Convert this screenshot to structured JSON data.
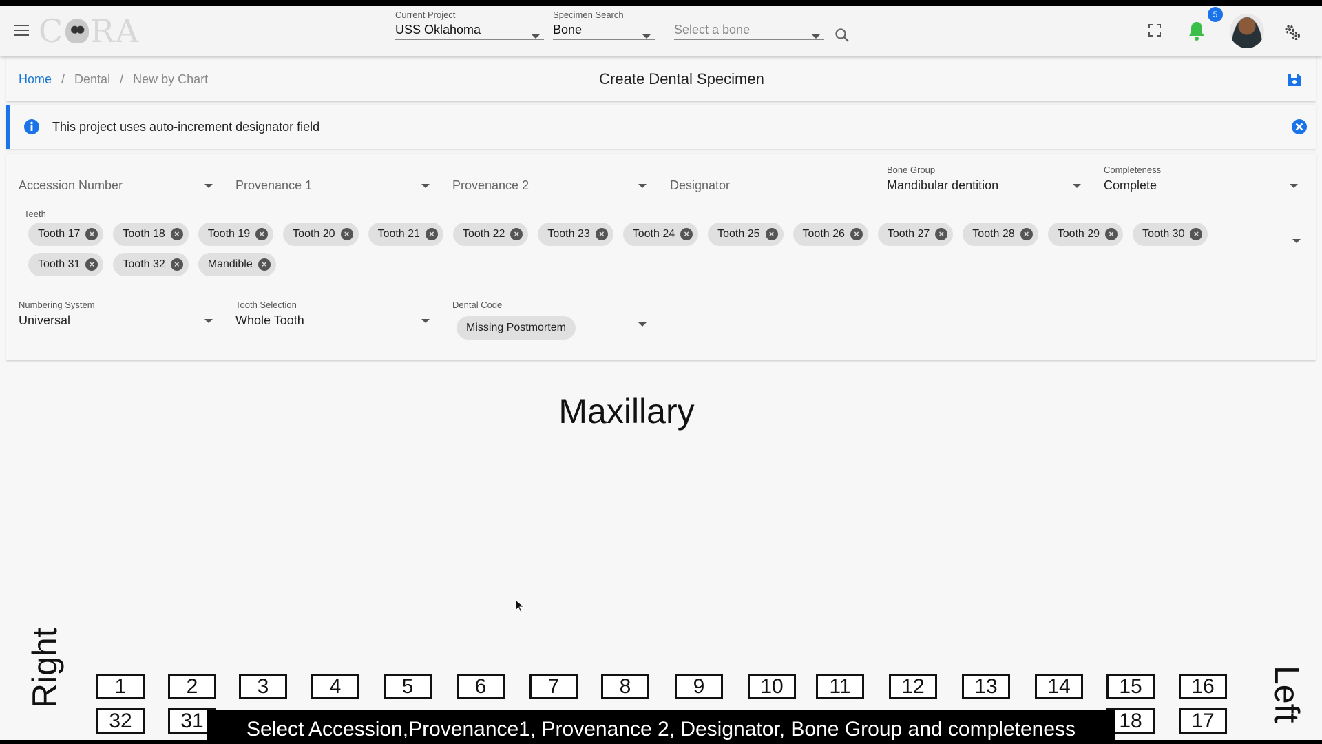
{
  "app": {
    "logo_text": "C RA"
  },
  "topbar": {
    "current_project": {
      "label": "Current Project",
      "value": "USS Oklahoma"
    },
    "specimen_search": {
      "label": "Specimen Search",
      "value": "Bone"
    },
    "bone_select": {
      "placeholder": "Select a bone"
    },
    "notification_count": "5",
    "icons": [
      "menu-icon",
      "search-icon",
      "fullscreen-icon",
      "bell-icon",
      "settings-icon"
    ]
  },
  "breadcrumb": {
    "home": "Home",
    "dental": "Dental",
    "current": "New by Chart",
    "sep": "/"
  },
  "page": {
    "title": "Create Dental Specimen"
  },
  "alert": {
    "message": "This project uses auto-increment designator field",
    "color": "#1a73e8"
  },
  "form": {
    "accession": {
      "placeholder": "Accession Number"
    },
    "provenance1": {
      "placeholder": "Provenance 1"
    },
    "provenance2": {
      "placeholder": "Provenance 2"
    },
    "designator": {
      "placeholder": "Designator"
    },
    "bone_group": {
      "label": "Bone Group",
      "value": "Mandibular dentition"
    },
    "completeness": {
      "label": "Completeness",
      "value": "Complete"
    },
    "teeth": {
      "label": "Teeth",
      "chips": [
        "Tooth 17",
        "Tooth 18",
        "Tooth 19",
        "Tooth 20",
        "Tooth 21",
        "Tooth 22",
        "Tooth 23",
        "Tooth 24",
        "Tooth 25",
        "Tooth 26",
        "Tooth 27",
        "Tooth 28",
        "Tooth 29",
        "Tooth 30",
        "Tooth 31",
        "Tooth 32",
        "Mandible"
      ]
    },
    "numbering_system": {
      "label": "Numbering System",
      "value": "Universal"
    },
    "tooth_selection": {
      "label": "Tooth Selection",
      "value": "Whole Tooth"
    },
    "dental_code": {
      "label": "Dental Code",
      "value": "Missing Postmortem"
    }
  },
  "chart": {
    "title": "Maxillary",
    "right_label": "Right",
    "left_label": "Left",
    "upper_teeth": [
      "1",
      "2",
      "3",
      "4",
      "5",
      "6",
      "7",
      "8",
      "9",
      "10",
      "11",
      "12",
      "13",
      "14",
      "15",
      "16"
    ],
    "lower_teeth_visible": [
      "32",
      "31",
      "18",
      "17"
    ]
  },
  "caption": "Select Accession,Provenance1, Provenance 2, Designator, Bone Group and completeness"
}
